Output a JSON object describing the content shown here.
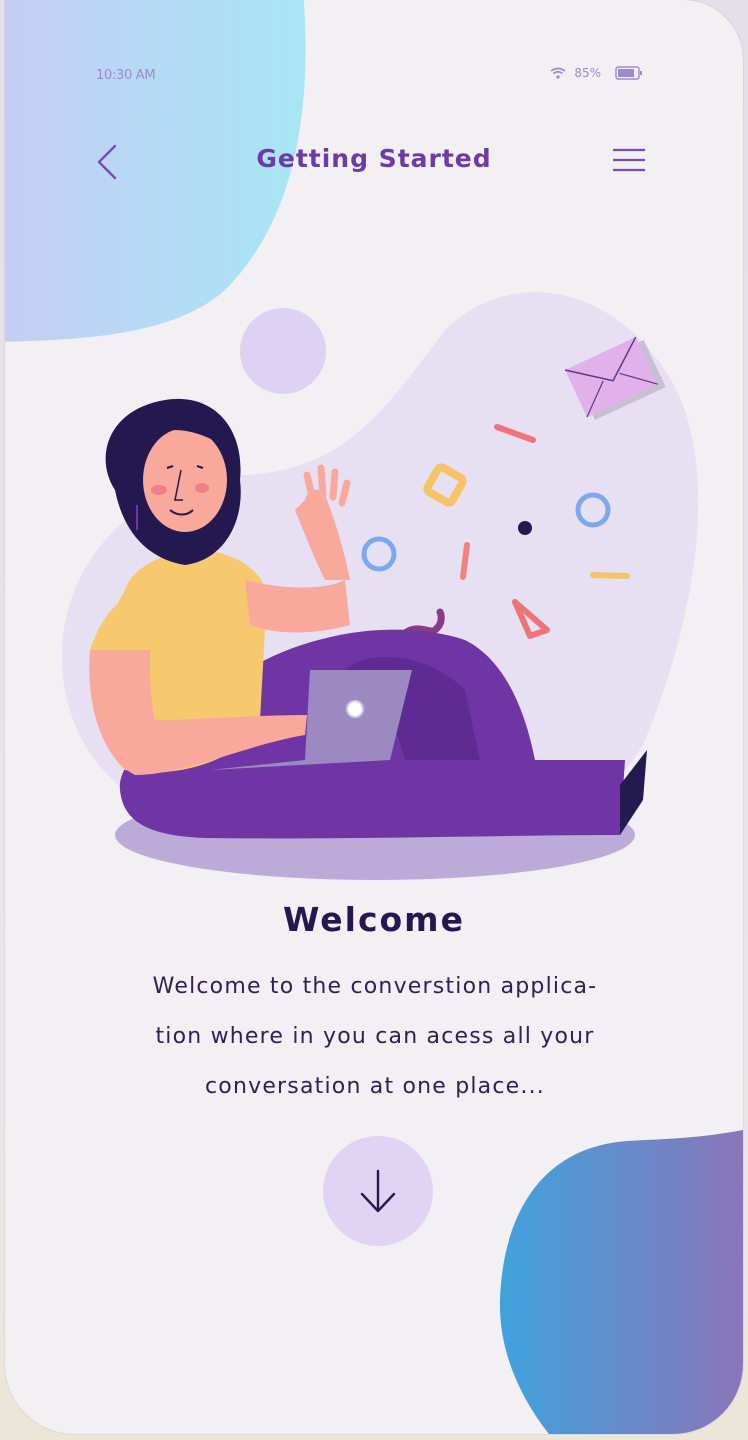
{
  "status_bar": {
    "time": "10:30 AM",
    "battery_percent": "85%",
    "wifi_icon": "wifi-icon",
    "battery_icon": "battery-icon"
  },
  "header": {
    "title": "Getting Started",
    "back_icon": "chevron-left-icon",
    "menu_icon": "hamburger-menu-icon"
  },
  "onboarding": {
    "heading": "Welcome",
    "body_lines": [
      "Welcome to the converstion applica-",
      "tion where in you can acess all your",
      "conversation at one place..."
    ],
    "next_icon": "arrow-down-icon"
  },
  "colors": {
    "accent": "#6e3aa8",
    "heading": "#23184f",
    "background": "#f2f0f3",
    "button": "#e1d3f3"
  }
}
